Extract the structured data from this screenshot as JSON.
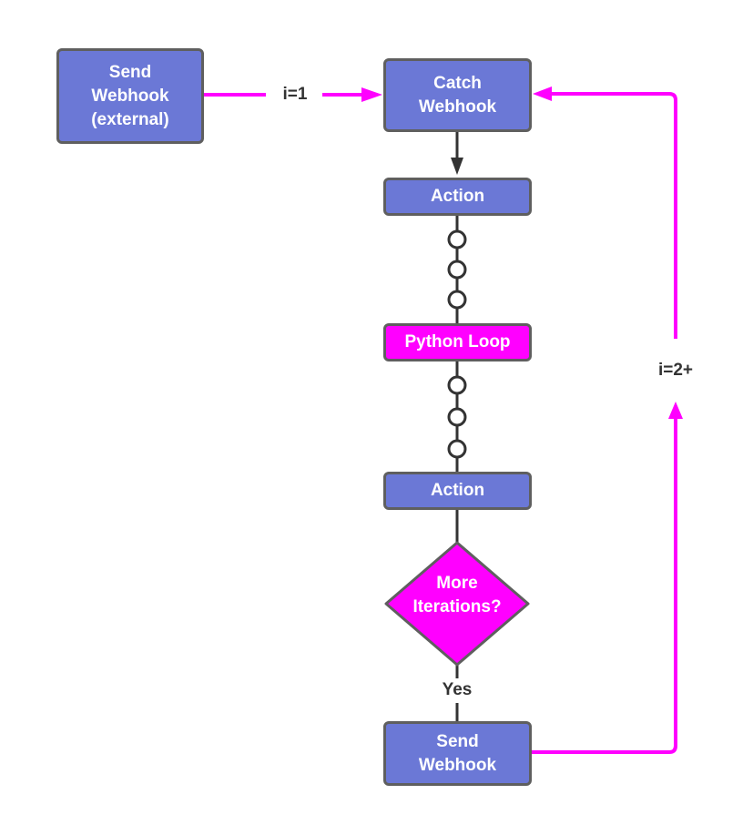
{
  "diagram": {
    "nodes": {
      "send_webhook_external": "Send\nWebhook\n(external)",
      "catch_webhook": "Catch\nWebhook",
      "action_1": "Action",
      "python_loop": "Python Loop",
      "action_2": "Action",
      "decision": "More\nIterations?",
      "send_webhook": "Send\nWebhook"
    },
    "edge_labels": {
      "first_iteration": "i=1",
      "loop_iteration": "i=2+",
      "yes": "Yes"
    },
    "colors": {
      "step_fill": "#6b78d6",
      "highlight_fill": "#ff00ff",
      "border": "#5f5f5f",
      "connector": "#333333",
      "loop_connector": "#ff00ff"
    }
  }
}
